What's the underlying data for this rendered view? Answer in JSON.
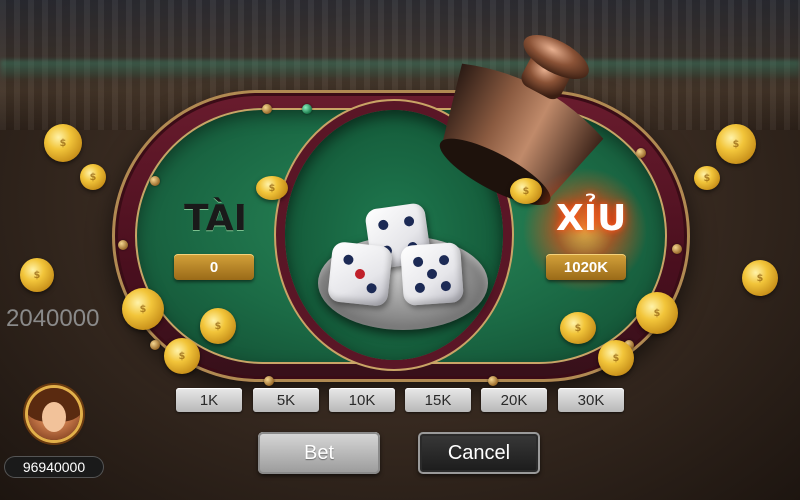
{
  "table": {
    "left_label": "TÀI",
    "right_label": "XỈU",
    "left_amount": "0",
    "right_amount": "1020K"
  },
  "bet_chips": [
    {
      "label": "1K"
    },
    {
      "label": "5K"
    },
    {
      "label": "10K"
    },
    {
      "label": "15K"
    },
    {
      "label": "20K"
    },
    {
      "label": "30K"
    }
  ],
  "actions": {
    "bet_label": "Bet",
    "cancel_label": "Cancel"
  },
  "pot": "2040000",
  "player": {
    "avatar_icon": "female-avatar-icon",
    "balance": "96940000"
  },
  "dice": [
    {
      "face": 4
    },
    {
      "face": 3
    },
    {
      "face": 5
    }
  ],
  "colors": {
    "felt": "#1b6a45",
    "rail": "#4a0f1e",
    "gold": "#d4a23a",
    "xiu_glow": "#ff5a20"
  }
}
